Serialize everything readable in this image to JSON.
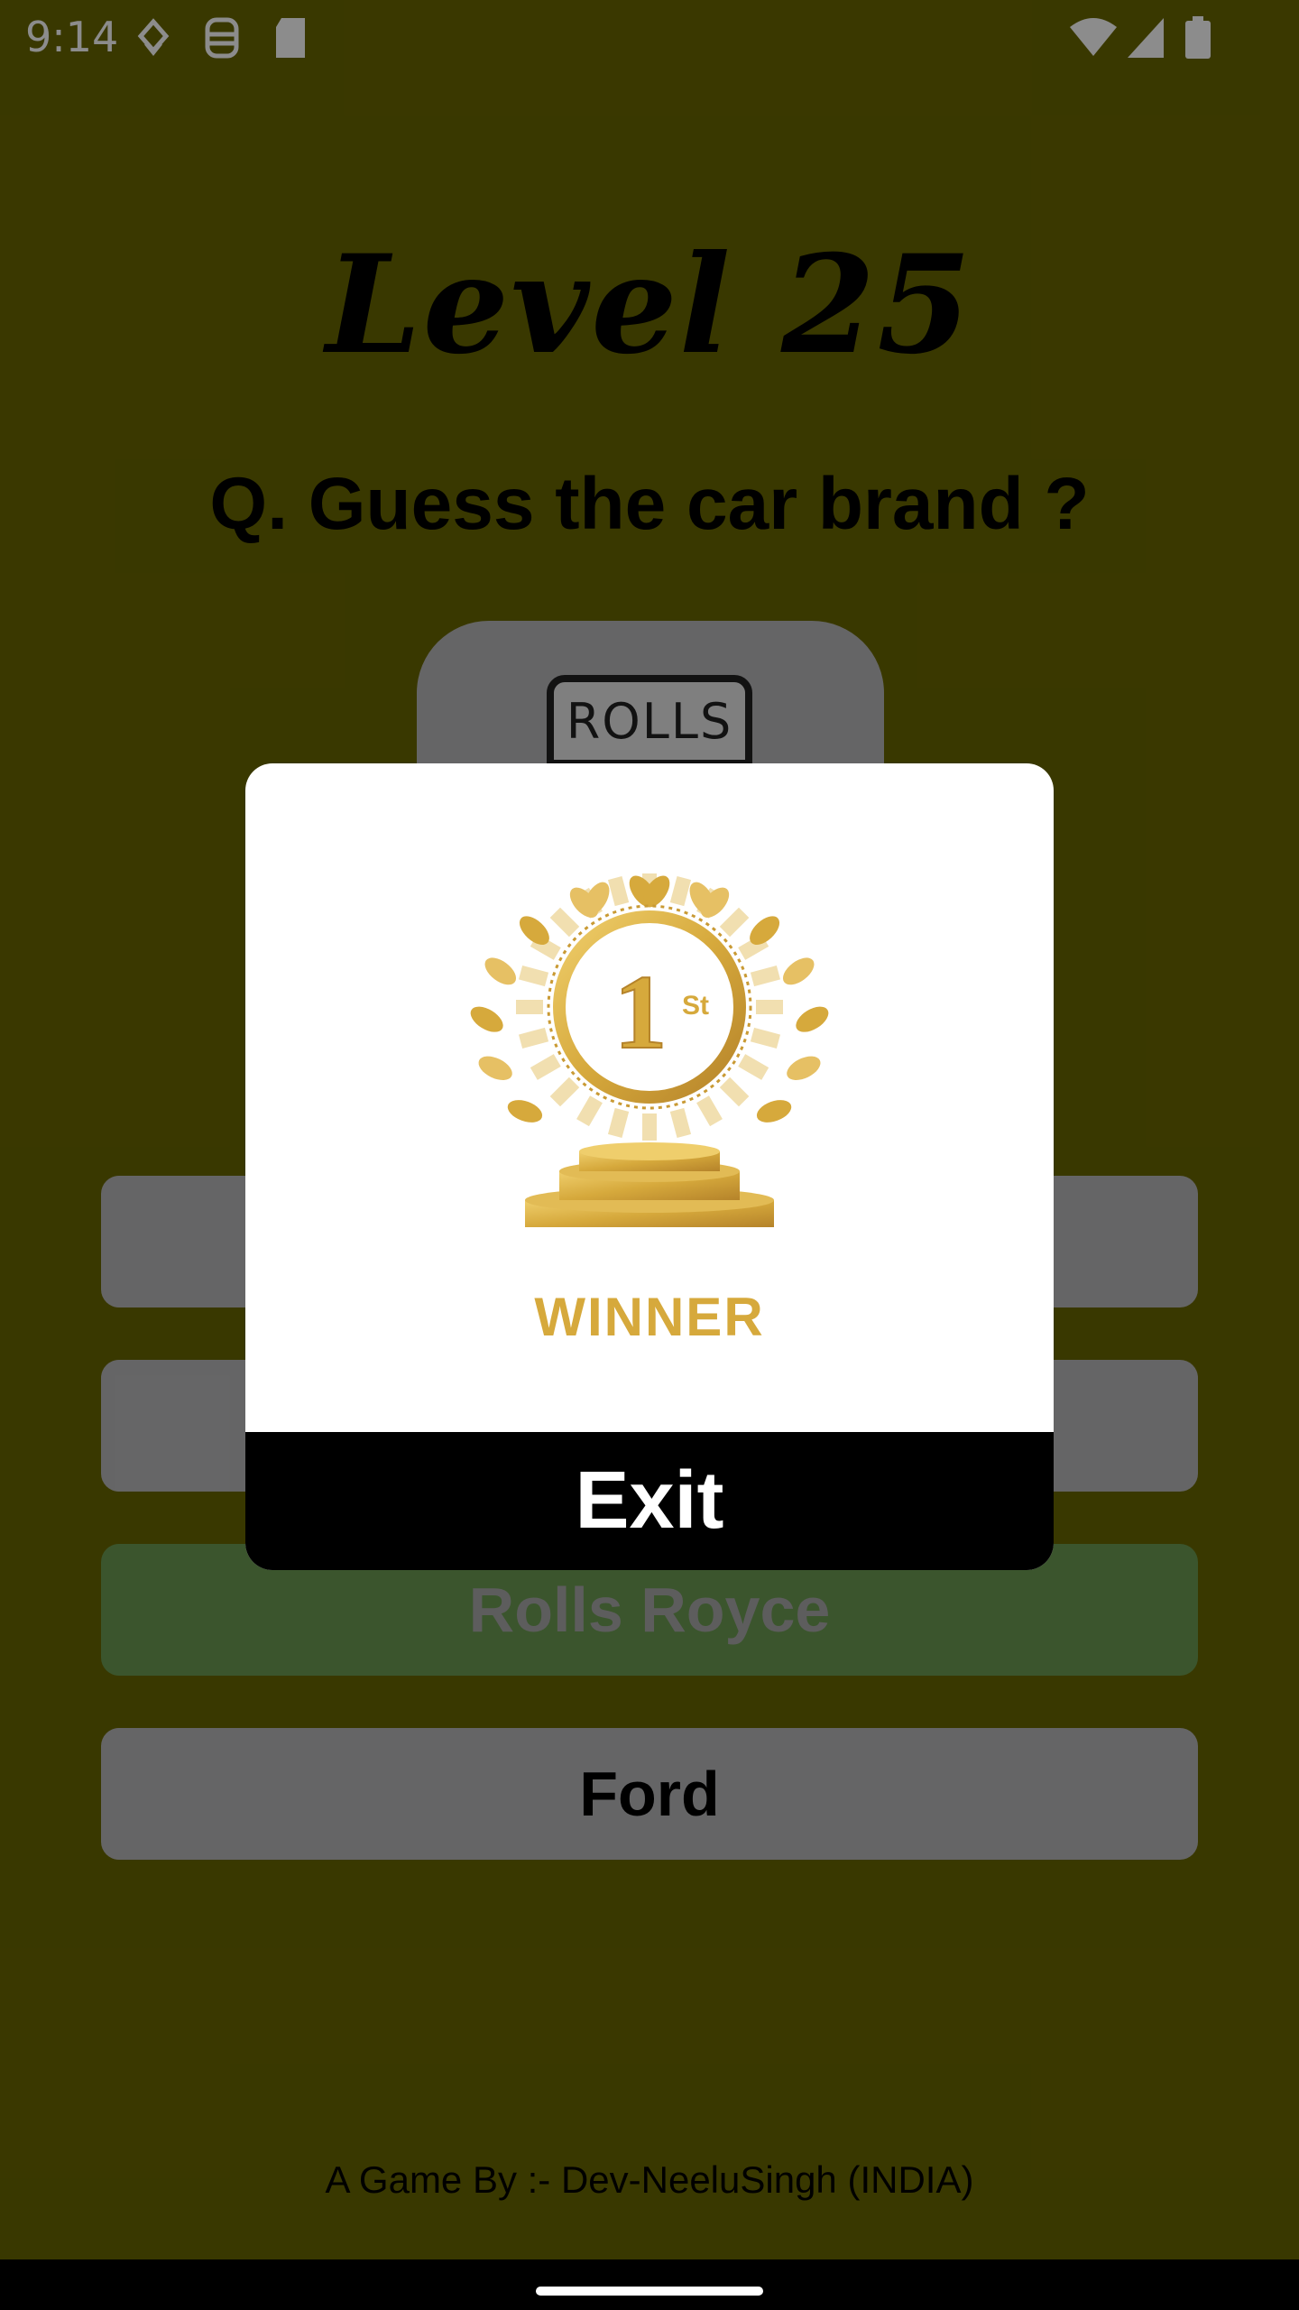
{
  "status_bar": {
    "time": "9:14",
    "icons": [
      "notification-icon",
      "face-icon",
      "sd-card-icon",
      "wifi-icon",
      "signal-icon",
      "battery-icon"
    ]
  },
  "game": {
    "level_title": "Level 25",
    "question": "Q. Guess the car brand ?",
    "logo_text": "ROLLS",
    "options": [
      {
        "label": "",
        "state": "default"
      },
      {
        "label": "",
        "state": "default"
      },
      {
        "label": "Rolls Royce",
        "state": "correct"
      },
      {
        "label": "Ford",
        "state": "default"
      }
    ],
    "footer": "A Game By :- Dev-NeeluSingh (INDIA)"
  },
  "dialog": {
    "medal_number": "1",
    "medal_suffix": "St",
    "winner_label": "WINNER",
    "exit_label": "Exit"
  },
  "colors": {
    "background": "#696600",
    "option": "#b9b9bb",
    "correct": "#6c9c52",
    "gold": "#d6a93c"
  }
}
